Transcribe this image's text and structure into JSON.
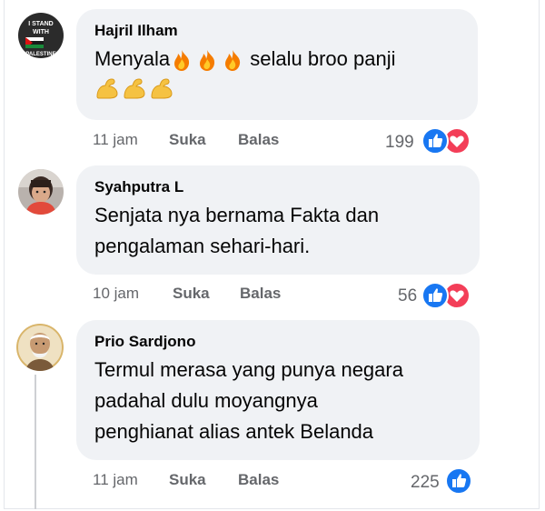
{
  "comments": [
    {
      "author": "Hajril Ilham",
      "text_before": "Menyala",
      "text_after": " selalu broo panji",
      "fire_emoji": "🔥",
      "muscle_emoji": "💪",
      "time": "11 jam",
      "like_label": "Suka",
      "reply_label": "Balas",
      "reaction_count": "199",
      "avatar_text": [
        "I STAND",
        "WITH",
        "PALESTINE"
      ]
    },
    {
      "author": "Syahputra L",
      "text": "Senjata nya bernama Fakta dan pengalaman sehari-hari.",
      "line1": "Senjata nya bernama Fakta dan",
      "line2": "pengalaman sehari-hari.",
      "time": "10 jam",
      "like_label": "Suka",
      "reply_label": "Balas",
      "reaction_count": "56"
    },
    {
      "author": "Prio Sardjono",
      "line1": "Termul merasa yang punya negara",
      "line2": "padahal dulu moyangnya",
      "line3": "penghianat alias antek Belanda",
      "time": "11 jam",
      "like_label": "Suka",
      "reply_label": "Balas",
      "reaction_count": "225"
    }
  ],
  "colors": {
    "bubble": "#f0f2f5",
    "meta_text": "#65676b",
    "like_blue": "#1877f2",
    "love_red": "#f33e58"
  },
  "icons": [
    "like-reaction-icon",
    "love-reaction-icon",
    "fire-emoji",
    "muscle-emoji"
  ]
}
